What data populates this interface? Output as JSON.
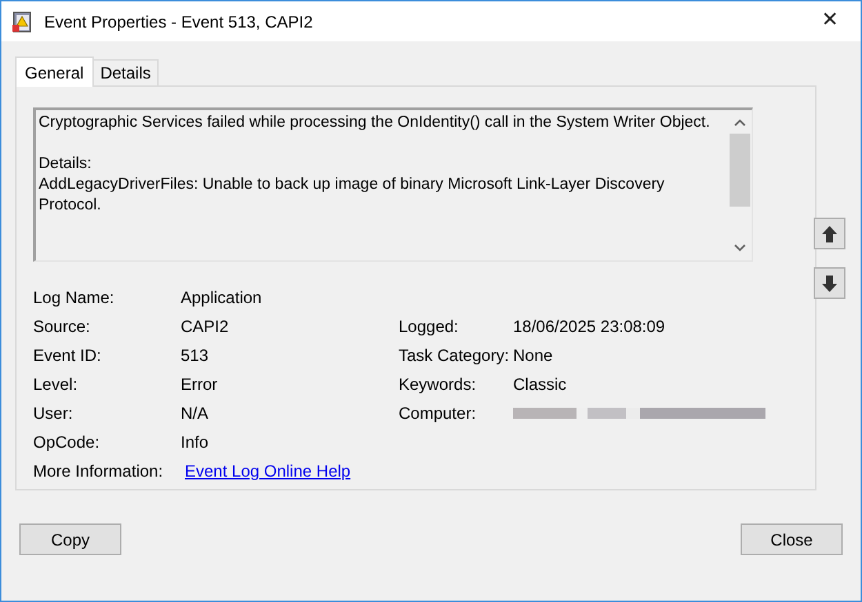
{
  "window": {
    "title": "Event Properties - Event 513, CAPI2",
    "close_glyph": "✕"
  },
  "tabs": [
    {
      "label": "General",
      "selected": true
    },
    {
      "label": "Details",
      "selected": false
    }
  ],
  "description": [
    [
      "Cryptographic Services failed while processing the OnIdentity() call in the System Writer Object."
    ],
    [
      "Details:",
      "AddLegacyDriverFiles: Unable to back up image of binary Microsoft Link-Layer Discovery Protocol."
    ]
  ],
  "fields": [
    {
      "left": {
        "label": "Log Name:",
        "value": "Application"
      }
    },
    {
      "left": {
        "label": "Source:",
        "value": "CAPI2"
      },
      "right": {
        "label": "Logged:",
        "kind": "text",
        "value": "18/06/2025 23:08:09"
      }
    },
    {
      "left": {
        "label": "Event ID:",
        "value": "513"
      },
      "right": {
        "label": "Task Category:",
        "kind": "text",
        "value": "None"
      }
    },
    {
      "left": {
        "label": "Level:",
        "value": "Error"
      },
      "right": {
        "label": "Keywords:",
        "kind": "text",
        "value": "Classic"
      }
    },
    {
      "left": {
        "label": "User:",
        "value": "N/A"
      },
      "right": {
        "label": "Computer:",
        "kind": "redacted"
      }
    },
    {
      "left": {
        "label": "OpCode:",
        "value": "Info"
      }
    }
  ],
  "more_information": {
    "label": "More Information:",
    "link": "Event Log Online Help"
  },
  "buttons": [
    {
      "label": "Copy"
    },
    {
      "label": "Close"
    }
  ]
}
